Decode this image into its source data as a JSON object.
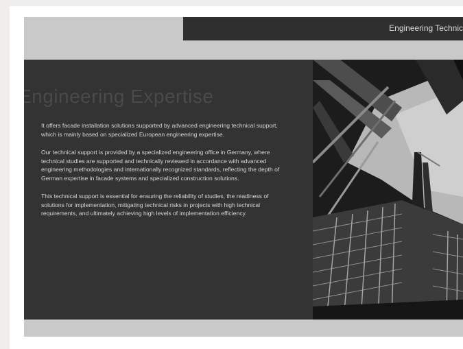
{
  "slide": {
    "top_bar_title": "Engineering Technic",
    "heading": "Engineering Expertise",
    "paragraphs": [
      "It offers facade installation solutions supported by advanced engineering technical support, which is mainly based on specialized European engineering expertise.",
      "Our technical support is provided by a specialized engineering office in Germany, where technical studies are supported and technically reviewed in accordance with advanced engineering methodologies and internationally recognized standards, reflecting the depth of German expertise in facade systems and specialized construction solutions.",
      "This technical support is essential for ensuring the reliability of studies, the readiness of solutions for implementation, mitigating technical risks in projects with high technical requirements, and ultimately achieving high levels of implementation efficiency."
    ]
  },
  "colors": {
    "page_bg": "#efeeec",
    "slide_bg": "#c9c9c9",
    "panel_bg": "#333333",
    "top_bar_bg": "#2f2f2f"
  },
  "image": {
    "subject": "building-facade-photo"
  }
}
